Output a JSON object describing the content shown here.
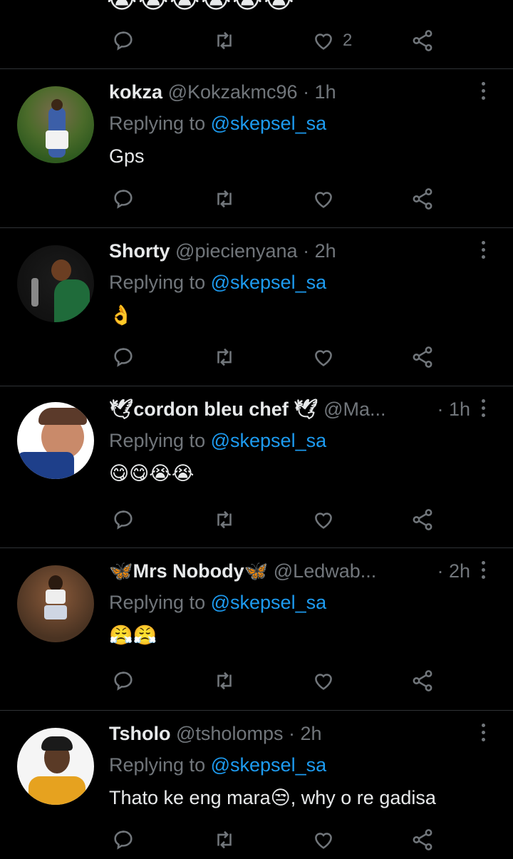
{
  "top_tweet": {
    "emoji": "😭😭😭😭😭😭",
    "like_count": "2"
  },
  "replies_label": "Replying to",
  "tweets": [
    {
      "display_name": "kokza",
      "handle": "@Kokzakmc96",
      "time": "· 1h",
      "mention": "@skepsel_sa",
      "text": "Gps"
    },
    {
      "display_name": "Shorty",
      "handle": "@piecienyana",
      "time": "· 2h",
      "mention": "@skepsel_sa",
      "text": "👌"
    },
    {
      "display_name": "🕊cordon bleu chef 🕊",
      "handle": "@Ma...",
      "time": "· 1h",
      "mention": "@skepsel_sa",
      "text": "😋😋😭😭"
    },
    {
      "display_name": "🦋Mrs Nobody🦋",
      "handle": "@Ledwab...",
      "time": "· 2h",
      "mention": "@skepsel_sa",
      "text": "😤😤"
    },
    {
      "display_name": "Tsholo",
      "handle": "@tsholomps",
      "time": "· 2h",
      "mention": "@skepsel_sa",
      "text": "Thato ke eng mara😒, why o re gadisa"
    }
  ],
  "colors": {
    "background": "#000000",
    "text": "#e7e9ea",
    "muted": "#71767b",
    "link": "#1d9bf0",
    "divider": "#2f3336"
  },
  "icons": [
    "reply-icon",
    "retweet-icon",
    "like-icon",
    "share-icon",
    "more-icon"
  ]
}
